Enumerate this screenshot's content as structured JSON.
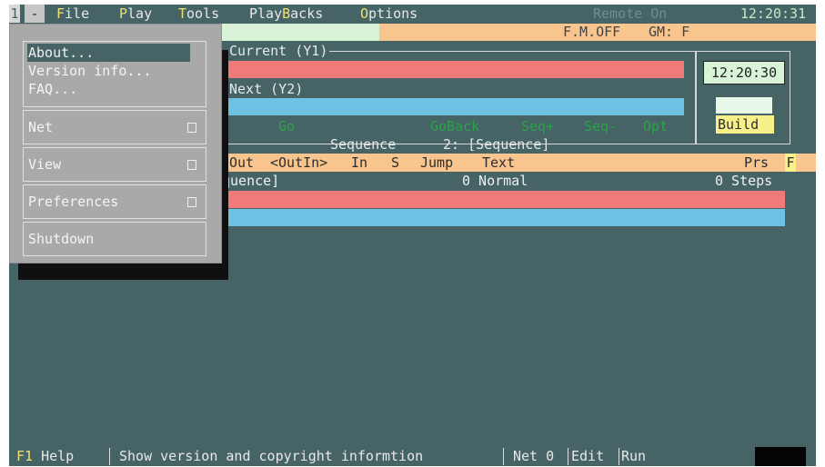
{
  "menubar": {
    "screen_number": "1",
    "system_menu": "-",
    "items": [
      {
        "hot": "F",
        "rest": "ile"
      },
      {
        "hot": "P",
        "rest": "lay"
      },
      {
        "hot": "T",
        "rest": "ools"
      },
      {
        "pre": "Play",
        "hot": "B",
        "rest": "acks"
      },
      {
        "hot": "O",
        "rest": "ptions"
      }
    ],
    "remote_status": "Remote On",
    "clock": "12:20:31"
  },
  "infobar": {
    "fm": "F.M.OFF",
    "gm": "GM: F"
  },
  "current": {
    "title": "Current (Y1)"
  },
  "next": {
    "title": "Next (Y2)"
  },
  "clock_box": "12:20:30",
  "function_keys": {
    "go": "Go",
    "goback": "GoBack",
    "seq_plus": "Seq+",
    "seq_minus": "Seq-",
    "opt": "Opt"
  },
  "mode": {
    "build": "Build"
  },
  "sequence": {
    "label": "Sequence",
    "value": "2: [Sequence]"
  },
  "list": {
    "headers": {
      "out": "Out",
      "outin": "<OutIn>",
      "in": "In",
      "s": "S",
      "jump": "Jump",
      "text": "Text",
      "prs": "Prs",
      "f": "F"
    },
    "row": {
      "name": "quence]",
      "mode": "0 Normal",
      "steps": "0 Steps"
    }
  },
  "dropdown": {
    "about": "About...",
    "version": "Version info...",
    "faq": "FAQ...",
    "net": "Net",
    "view": "View",
    "preferences": "Preferences",
    "shutdown": "Shutdown"
  },
  "statusbar": {
    "f1": "F1",
    "help": "Help",
    "message": "Show version and copyright informtion",
    "net": "Net 0",
    "edit": "Edit",
    "run": "Run"
  },
  "colors": {
    "background": "#466466",
    "highlight": "#f0e070",
    "red_bar": "#f07a7a",
    "blue_bar": "#6ec3e5",
    "orange_band": "#f9c58e",
    "green_band": "#d8f3d8",
    "fkey": "#2aa34a"
  }
}
